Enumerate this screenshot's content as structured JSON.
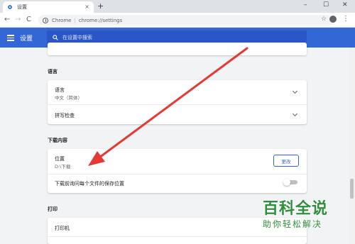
{
  "browser": {
    "tab_title": "设置",
    "tab_close": "×",
    "new_tab": "+",
    "window_minimize": "–",
    "window_maximize": "☐",
    "window_close": "✕",
    "back": "←",
    "forward": "→",
    "reload": "C",
    "omnibox_host": "Chrome",
    "omnibox_sep": "|",
    "omnibox_url": "chrome://settings",
    "star": "☆",
    "kebab": "⋮"
  },
  "header": {
    "title": "设置",
    "search_placeholder": "在设置中搜索"
  },
  "sections": {
    "language": {
      "title": "语言",
      "language_label": "语言",
      "language_value": "中文（简体）",
      "spellcheck_label": "拼写检查"
    },
    "downloads": {
      "title": "下载内容",
      "location_label": "位置",
      "location_value": "D:\\下载",
      "change_button": "更改",
      "ask_label": "下载前询问每个文件的保存位置",
      "ask_enabled": false
    },
    "printing": {
      "title": "打印",
      "printer_label": "打印机"
    }
  },
  "colors": {
    "header_blue": "#3367d6",
    "annotation_red": "#e53935",
    "watermark_green": "#2f8f3c"
  },
  "watermark": {
    "main": "百科全说",
    "sub": "助你轻松解决"
  }
}
